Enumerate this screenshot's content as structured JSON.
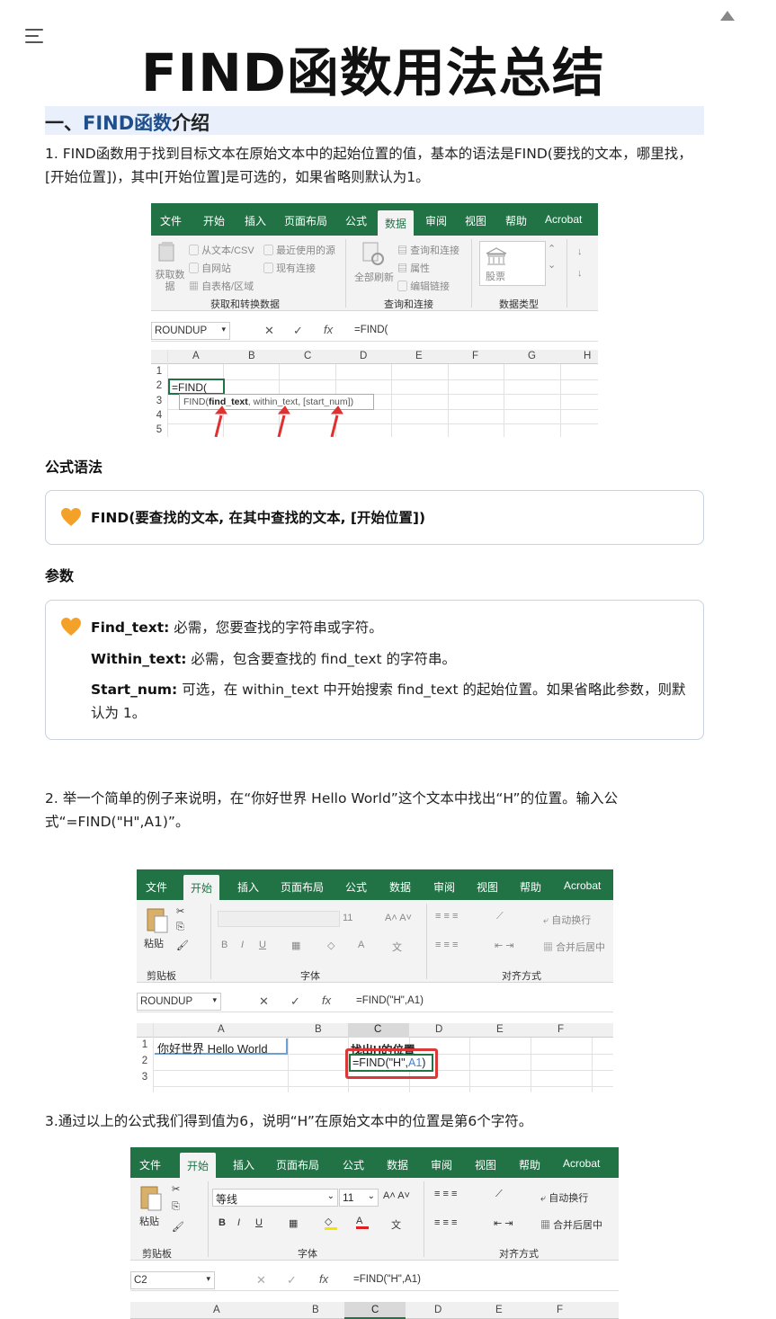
{
  "title": "FIND函数用法总结",
  "section1": {
    "prefix": "一、",
    "highlight": "FIND函数",
    "suffix": "介绍"
  },
  "para1": "1. FIND函数用于找到目标文本在原始文本中的起始位置的值，基本的语法是FIND(要找的文本，哪里找，[开始位置])，其中[开始位置]是可选的，如果省略则默认为1。",
  "syntax_heading": "公式语法",
  "syntax_box": "FIND(要查找的文本, 在其中查找的文本, [开始位置])",
  "params_heading": "参数",
  "params": [
    {
      "name": "Find_text:",
      "desc": " 必需，您要查找的字符串或字符。"
    },
    {
      "name": "Within_text:",
      "desc": " 必需，包含要查找的 find_text 的字符串。"
    },
    {
      "name": "Start_num:",
      "desc": " 可选，在 within_text 中开始搜索 find_text 的起始位置。如果省略此参数，则默认为 1。"
    }
  ],
  "para2": "2. 举一个简单的例子来说明，在“你好世界 Hello World”这个文本中找出“H”的位置。输入公式“=FIND(\"H\",A1)”。",
  "para3": "3.通过以上的公式我们得到值为6，说明“H”在原始文本中的位置是第6个字符。",
  "excel1": {
    "tabs": [
      "文件",
      "开始",
      "插入",
      "页面布局",
      "公式",
      "数据",
      "审阅",
      "视图",
      "帮助",
      "Acrobat"
    ],
    "active_tab": "数据",
    "ribbon": {
      "get_data": "获取数据",
      "from_csv": "从文本/CSV",
      "from_web": "自网站",
      "from_table": "自表格/区域",
      "recent": "最近使用的源",
      "existing": "现有连接",
      "group1": "获取和转换数据",
      "refresh_all": "全部刷新",
      "queries": "查询和连接",
      "properties": "属性",
      "edit_links": "编辑链接",
      "group2": "查询和连接",
      "stocks": "股票",
      "group3": "数据类型"
    },
    "name_box": "ROUNDUP",
    "formula": "=FIND(",
    "columns": [
      "A",
      "B",
      "C",
      "D",
      "E",
      "F",
      "G",
      "H"
    ],
    "rows": [
      "1",
      "2",
      "3",
      "4",
      "5"
    ],
    "cell_a2": "=FIND(",
    "tooltip_fn": "FIND(",
    "tooltip_arg1": "find_text",
    "tooltip_rest": ", within_text, [start_num])"
  },
  "excel2": {
    "tabs": [
      "文件",
      "开始",
      "插入",
      "页面布局",
      "公式",
      "数据",
      "审阅",
      "视图",
      "帮助",
      "Acrobat"
    ],
    "active_tab": "开始",
    "ribbon": {
      "paste": "粘贴",
      "clipboard": "剪贴板",
      "font_group": "字体",
      "font_size": "11",
      "wrap": "自动换行",
      "merge": "合并后居中",
      "align_group": "对齐方式"
    },
    "name_box": "ROUNDUP",
    "formula": "=FIND(\"H\",A1)",
    "columns": [
      "A",
      "B",
      "C",
      "D",
      "E",
      "F"
    ],
    "rows": [
      "1",
      "2",
      "3"
    ],
    "cell_a1": "你好世界 Hello World",
    "cell_c1": "找出H的位置",
    "cell_c2_prefix": "=FIND(\"H\",",
    "cell_c2_ref": "A1",
    "cell_c2_suffix": ")"
  },
  "excel3": {
    "tabs": [
      "文件",
      "开始",
      "插入",
      "页面布局",
      "公式",
      "数据",
      "审阅",
      "视图",
      "帮助",
      "Acrobat"
    ],
    "active_tab": "开始",
    "ribbon": {
      "paste": "粘贴",
      "clipboard": "剪贴板",
      "font_name": "等线",
      "font_size": "11",
      "font_group": "字体",
      "wrap": "自动换行",
      "merge": "合并后居中",
      "align_group": "对齐方式"
    },
    "name_box": "C2",
    "formula": "=FIND(\"H\",A1)",
    "columns": [
      "A",
      "B",
      "C",
      "D",
      "E",
      "F"
    ]
  },
  "colors": {
    "excel_green": "#217346",
    "section_bg": "#eaf0fb",
    "highlight_blue": "#1f4e8c",
    "red_box": "#d83a3a",
    "heart": "#f4a12a"
  }
}
